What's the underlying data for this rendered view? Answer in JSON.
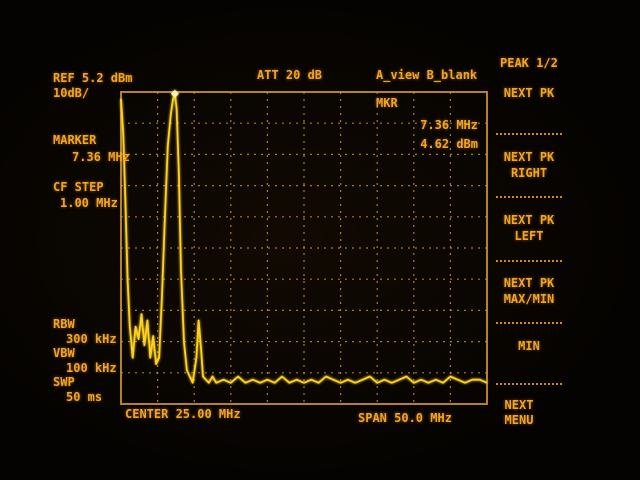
{
  "header": {
    "ref_level": "REF 5.2 dBm",
    "scale": "10dB/",
    "attenuation": "ATT 20 dB",
    "view_mode": "A_view B_blank"
  },
  "left_panel": {
    "marker_label": "MARKER",
    "marker_value": "7.36 MHz",
    "cf_step_label": "CF STEP",
    "cf_step_value": "1.00 MHz",
    "rbw_label": "RBW",
    "rbw_value": "300 kHz",
    "vbw_label": "VBW",
    "vbw_value": "100 kHz",
    "swp_label": "SWP",
    "swp_value": "50 ms"
  },
  "marker_readout": {
    "label": "MKR",
    "frequency": "7.36  MHz",
    "amplitude": "4.62  dBm"
  },
  "footer": {
    "center": "CENTER 25.00 MHz",
    "span": "SPAN 50.0 MHz"
  },
  "softkeys": {
    "title": "PEAK 1/2",
    "keys": [
      {
        "line1": "NEXT PK",
        "line2": ""
      },
      {
        "line1": "NEXT PK",
        "line2": "RIGHT"
      },
      {
        "line1": "NEXT PK",
        "line2": "LEFT"
      },
      {
        "line1": "NEXT PK",
        "line2": "MAX/MIN"
      },
      {
        "line1": "MIN",
        "line2": ""
      },
      {
        "line1": "NEXT",
        "line2": "MENU"
      }
    ]
  },
  "colors": {
    "trace": "#ffd21a",
    "text": "#f4a51e",
    "grid": "#d49a2a",
    "background": "#050301"
  },
  "chart_data": {
    "type": "line",
    "x_range": [
      0,
      50
    ],
    "y_range": [
      -94.8,
      5.2
    ],
    "x_unit": "MHz",
    "y_unit": "dBm",
    "grid": true,
    "marker": {
      "x": 7.36,
      "y": 4.62
    },
    "series": [
      {
        "x": [
          0.0,
          0.3,
          0.6,
          0.9,
          1.2,
          1.6,
          2.0,
          2.4,
          2.8,
          3.2,
          3.6,
          4.0,
          4.4,
          4.8,
          5.2,
          5.6,
          6.0,
          6.4,
          6.8,
          7.1,
          7.36,
          7.6,
          7.9,
          8.2,
          8.6,
          9.0,
          9.4,
          9.8,
          10.3,
          10.6,
          10.9,
          11.2,
          11.6,
          12.0,
          12.5,
          13.0,
          14,
          15,
          16,
          17,
          18,
          19,
          20,
          21,
          22,
          23,
          24,
          25,
          26,
          27,
          28,
          29,
          30,
          31,
          32,
          33,
          34,
          35,
          36,
          37,
          38,
          39,
          40,
          41,
          42,
          43,
          44,
          45,
          46,
          47,
          48,
          49,
          50
        ],
        "y": [
          3.0,
          -8,
          -30,
          -55,
          -70,
          -80,
          -70,
          -74,
          -66,
          -76,
          -68,
          -80,
          -73,
          -82,
          -80,
          -60,
          -35,
          -12,
          -2,
          3.0,
          4.62,
          0,
          -20,
          -52,
          -75,
          -84,
          -86,
          -88,
          -80,
          -68,
          -76,
          -86,
          -87,
          -88,
          -86,
          -88,
          -87,
          -88,
          -86,
          -88,
          -87,
          -88,
          -87,
          -88,
          -86,
          -88,
          -87,
          -88,
          -87,
          -88,
          -86,
          -87,
          -88,
          -87,
          -88,
          -87,
          -86,
          -88,
          -87,
          -88,
          -87,
          -86,
          -88,
          -87,
          -88,
          -87,
          -88,
          -86,
          -87,
          -88,
          -87,
          -87,
          -88
        ]
      }
    ]
  }
}
